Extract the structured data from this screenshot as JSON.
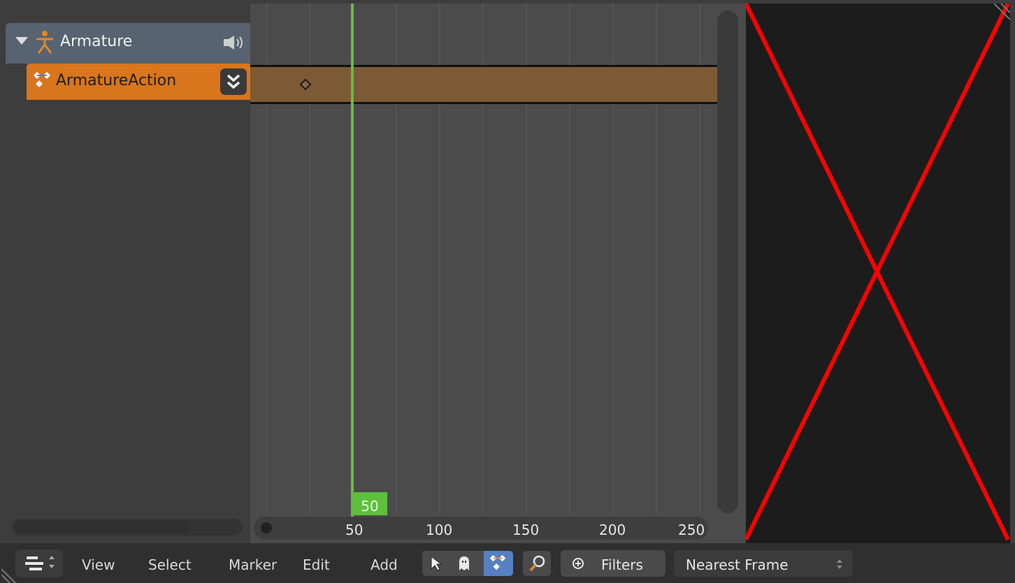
{
  "channels": {
    "object_label": "Armature",
    "action_label": "ArmatureAction"
  },
  "timeline": {
    "current_frame": "50",
    "ruler_ticks": [
      "50",
      "100",
      "150",
      "200",
      "250"
    ]
  },
  "header": {
    "menus": [
      "View",
      "Select",
      "Marker",
      "Edit",
      "Add"
    ],
    "filters_label": "Filters",
    "snap_mode": "Nearest Frame"
  },
  "colors": {
    "action_channel": "#d9751c",
    "playhead": "#60c040",
    "preview_cross": "#ff0000"
  }
}
